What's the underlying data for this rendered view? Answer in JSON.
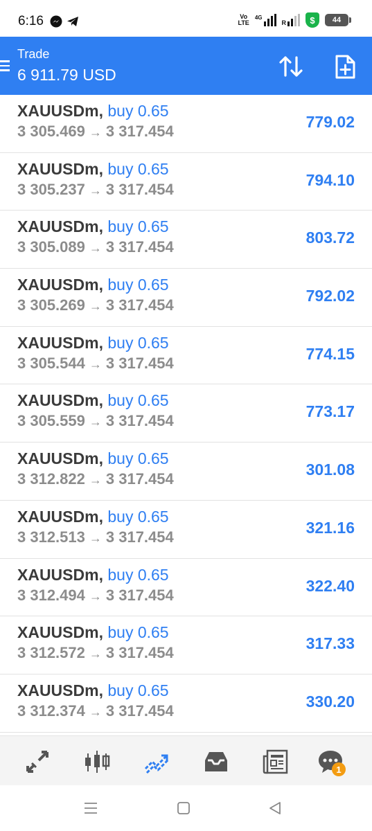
{
  "status_bar": {
    "time": "6:16",
    "volte_label": "Vo\nLTE",
    "network_label": "4G",
    "roaming_label": "R",
    "security_label": "$",
    "battery_level": "44"
  },
  "header": {
    "title": "Trade",
    "balance": "6 911.79 USD"
  },
  "positions": [
    {
      "symbol": "XAUUSDm",
      "type": "buy 0.65",
      "open_price": "3 305.469",
      "current_price": "3 317.454",
      "profit": "779.02"
    },
    {
      "symbol": "XAUUSDm",
      "type": "buy 0.65",
      "open_price": "3 305.237",
      "current_price": "3 317.454",
      "profit": "794.10"
    },
    {
      "symbol": "XAUUSDm",
      "type": "buy 0.65",
      "open_price": "3 305.089",
      "current_price": "3 317.454",
      "profit": "803.72"
    },
    {
      "symbol": "XAUUSDm",
      "type": "buy 0.65",
      "open_price": "3 305.269",
      "current_price": "3 317.454",
      "profit": "792.02"
    },
    {
      "symbol": "XAUUSDm",
      "type": "buy 0.65",
      "open_price": "3 305.544",
      "current_price": "3 317.454",
      "profit": "774.15"
    },
    {
      "symbol": "XAUUSDm",
      "type": "buy 0.65",
      "open_price": "3 305.559",
      "current_price": "3 317.454",
      "profit": "773.17"
    },
    {
      "symbol": "XAUUSDm",
      "type": "buy 0.65",
      "open_price": "3 312.822",
      "current_price": "3 317.454",
      "profit": "301.08"
    },
    {
      "symbol": "XAUUSDm",
      "type": "buy 0.65",
      "open_price": "3 312.513",
      "current_price": "3 317.454",
      "profit": "321.16"
    },
    {
      "symbol": "XAUUSDm",
      "type": "buy 0.65",
      "open_price": "3 312.494",
      "current_price": "3 317.454",
      "profit": "322.40"
    },
    {
      "symbol": "XAUUSDm",
      "type": "buy 0.65",
      "open_price": "3 312.572",
      "current_price": "3 317.454",
      "profit": "317.33"
    },
    {
      "symbol": "XAUUSDm",
      "type": "buy 0.65",
      "open_price": "3 312.374",
      "current_price": "3 317.454",
      "profit": "330.20"
    }
  ],
  "bottom_nav": {
    "items": [
      {
        "icon": "quotes-arrows-icon",
        "active": false
      },
      {
        "icon": "candlestick-chart-icon",
        "active": false
      },
      {
        "icon": "trade-trend-icon",
        "active": true
      },
      {
        "icon": "inbox-icon",
        "active": false
      },
      {
        "icon": "news-icon",
        "active": false
      },
      {
        "icon": "chat-icon",
        "active": false,
        "badge": "1"
      }
    ]
  },
  "colors": {
    "accent": "#2f7ff2",
    "header_bg": "#2f7ff2",
    "profit": "#2f7ff2",
    "price_text": "#8c8c8c",
    "symbol_text": "#3b3b3b",
    "badge": "#f39c12",
    "nav_icon": "#555555"
  }
}
